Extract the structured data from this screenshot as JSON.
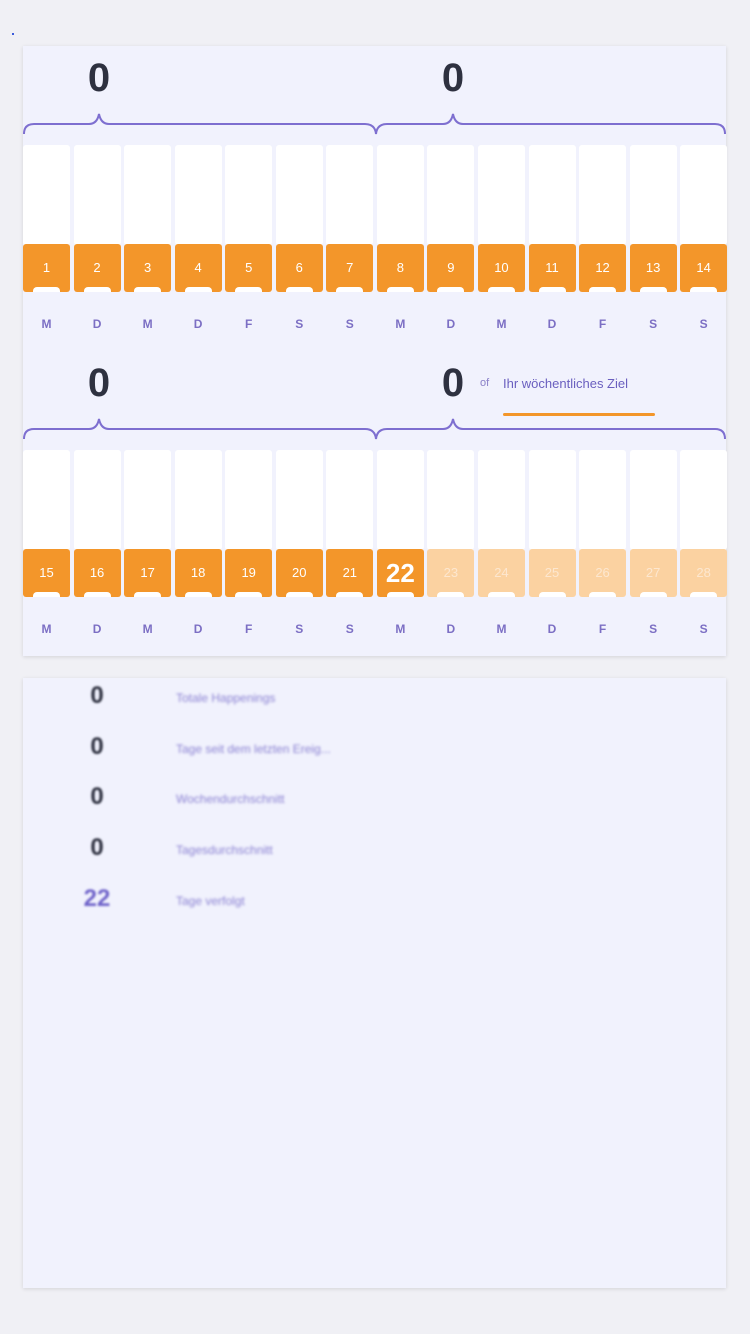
{
  "colors": {
    "accent_orange": "#f3962a",
    "accent_orange_light": "#fbd2a1",
    "purple": "#7c6fc4",
    "card_bg": "#f1f2fd",
    "page_bg": "#f0f0f5"
  },
  "period1": {
    "week_totals": [
      "0",
      "0"
    ],
    "days": [
      "1",
      "2",
      "3",
      "4",
      "5",
      "6",
      "7",
      "8",
      "9",
      "10",
      "11",
      "12",
      "13",
      "14"
    ],
    "letters": [
      "M",
      "D",
      "M",
      "D",
      "F",
      "S",
      "S",
      "M",
      "D",
      "M",
      "D",
      "F",
      "S",
      "S"
    ]
  },
  "period2": {
    "week_totals": [
      "0",
      "0"
    ],
    "goal_of": "of",
    "goal_label": "Ihr wöchentliches Ziel",
    "days": [
      "15",
      "16",
      "17",
      "18",
      "19",
      "20",
      "21",
      "22",
      "23",
      "24",
      "25",
      "26",
      "27",
      "28"
    ],
    "today": "22",
    "letters": [
      "M",
      "D",
      "M",
      "D",
      "F",
      "S",
      "S",
      "M",
      "D",
      "M",
      "D",
      "F",
      "S",
      "S"
    ]
  },
  "stats": [
    {
      "value": "0",
      "label": "Totale Happenings"
    },
    {
      "value": "0",
      "label": "Tage seit dem letzten Ereig..."
    },
    {
      "value": "0",
      "label": "Wochendurchschnitt"
    },
    {
      "value": "0",
      "label": "Tagesdurchschnitt"
    },
    {
      "value": "22",
      "label": "Tage verfolgt"
    }
  ]
}
